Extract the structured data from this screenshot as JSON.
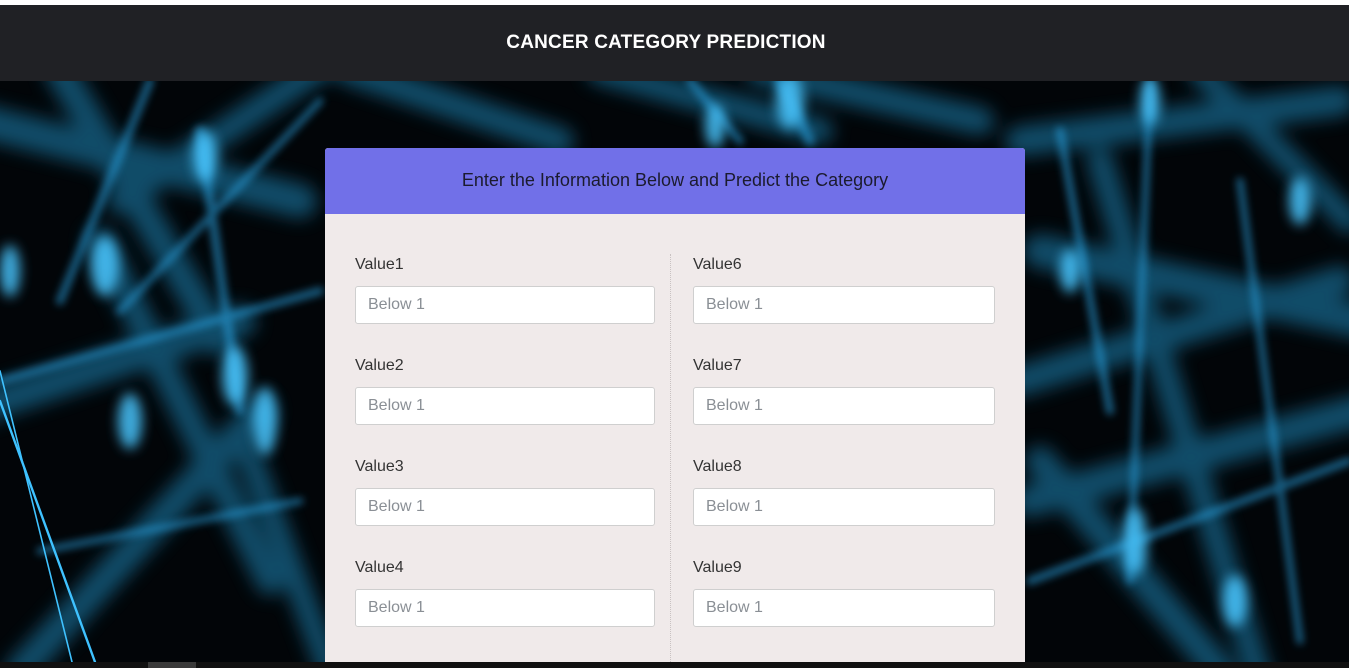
{
  "navbar": {
    "title": "CANCER CATEGORY PREDICTION"
  },
  "card": {
    "header": "Enter the Information Below and Predict the Category",
    "left_fields": [
      {
        "label": "Value1",
        "placeholder": "Below 1",
        "value": ""
      },
      {
        "label": "Value2",
        "placeholder": "Below 1",
        "value": ""
      },
      {
        "label": "Value3",
        "placeholder": "Below 1",
        "value": ""
      },
      {
        "label": "Value4",
        "placeholder": "Below 1",
        "value": ""
      }
    ],
    "right_fields": [
      {
        "label": "Value6",
        "placeholder": "Below 1",
        "value": ""
      },
      {
        "label": "Value7",
        "placeholder": "Below 1",
        "value": ""
      },
      {
        "label": "Value8",
        "placeholder": "Below 1",
        "value": ""
      },
      {
        "label": "Value9",
        "placeholder": "Below 1",
        "value": ""
      }
    ]
  },
  "colors": {
    "navbar_bg": "#202125",
    "card_header_bg": "#7170e8",
    "card_body_bg": "#f0eaea",
    "background_accent": "#2ab4ff"
  }
}
